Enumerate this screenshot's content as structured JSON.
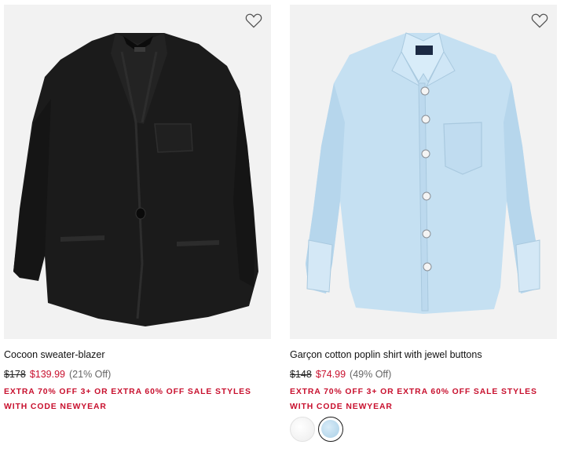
{
  "products": [
    {
      "name": "Cocoon sweater-blazer",
      "original_price": "$178",
      "sale_price": "$139.99",
      "discount": "(21% Off)",
      "promo": "EXTRA 70% OFF 3+ OR EXTRA 60% OFF SALE STYLES WITH CODE NEWYEAR",
      "image_icon": "black-sweater-blazer",
      "wishlist_icon": "heart-outline-icon"
    },
    {
      "name": "Garçon cotton poplin shirt with jewel buttons",
      "original_price": "$148",
      "sale_price": "$74.99",
      "discount": "(49% Off)",
      "promo": "EXTRA 70% OFF 3+ OR EXTRA 60% OFF SALE STYLES WITH CODE NEWYEAR",
      "image_icon": "light-blue-button-shirt",
      "wishlist_icon": "heart-outline-icon",
      "swatches": [
        {
          "color": "#f5f5f5",
          "selected": false
        },
        {
          "color": "#b8d8ec",
          "selected": true
        }
      ]
    }
  ],
  "colors": {
    "sale": "#c8102e",
    "image_bg": "#f2f2f2"
  }
}
